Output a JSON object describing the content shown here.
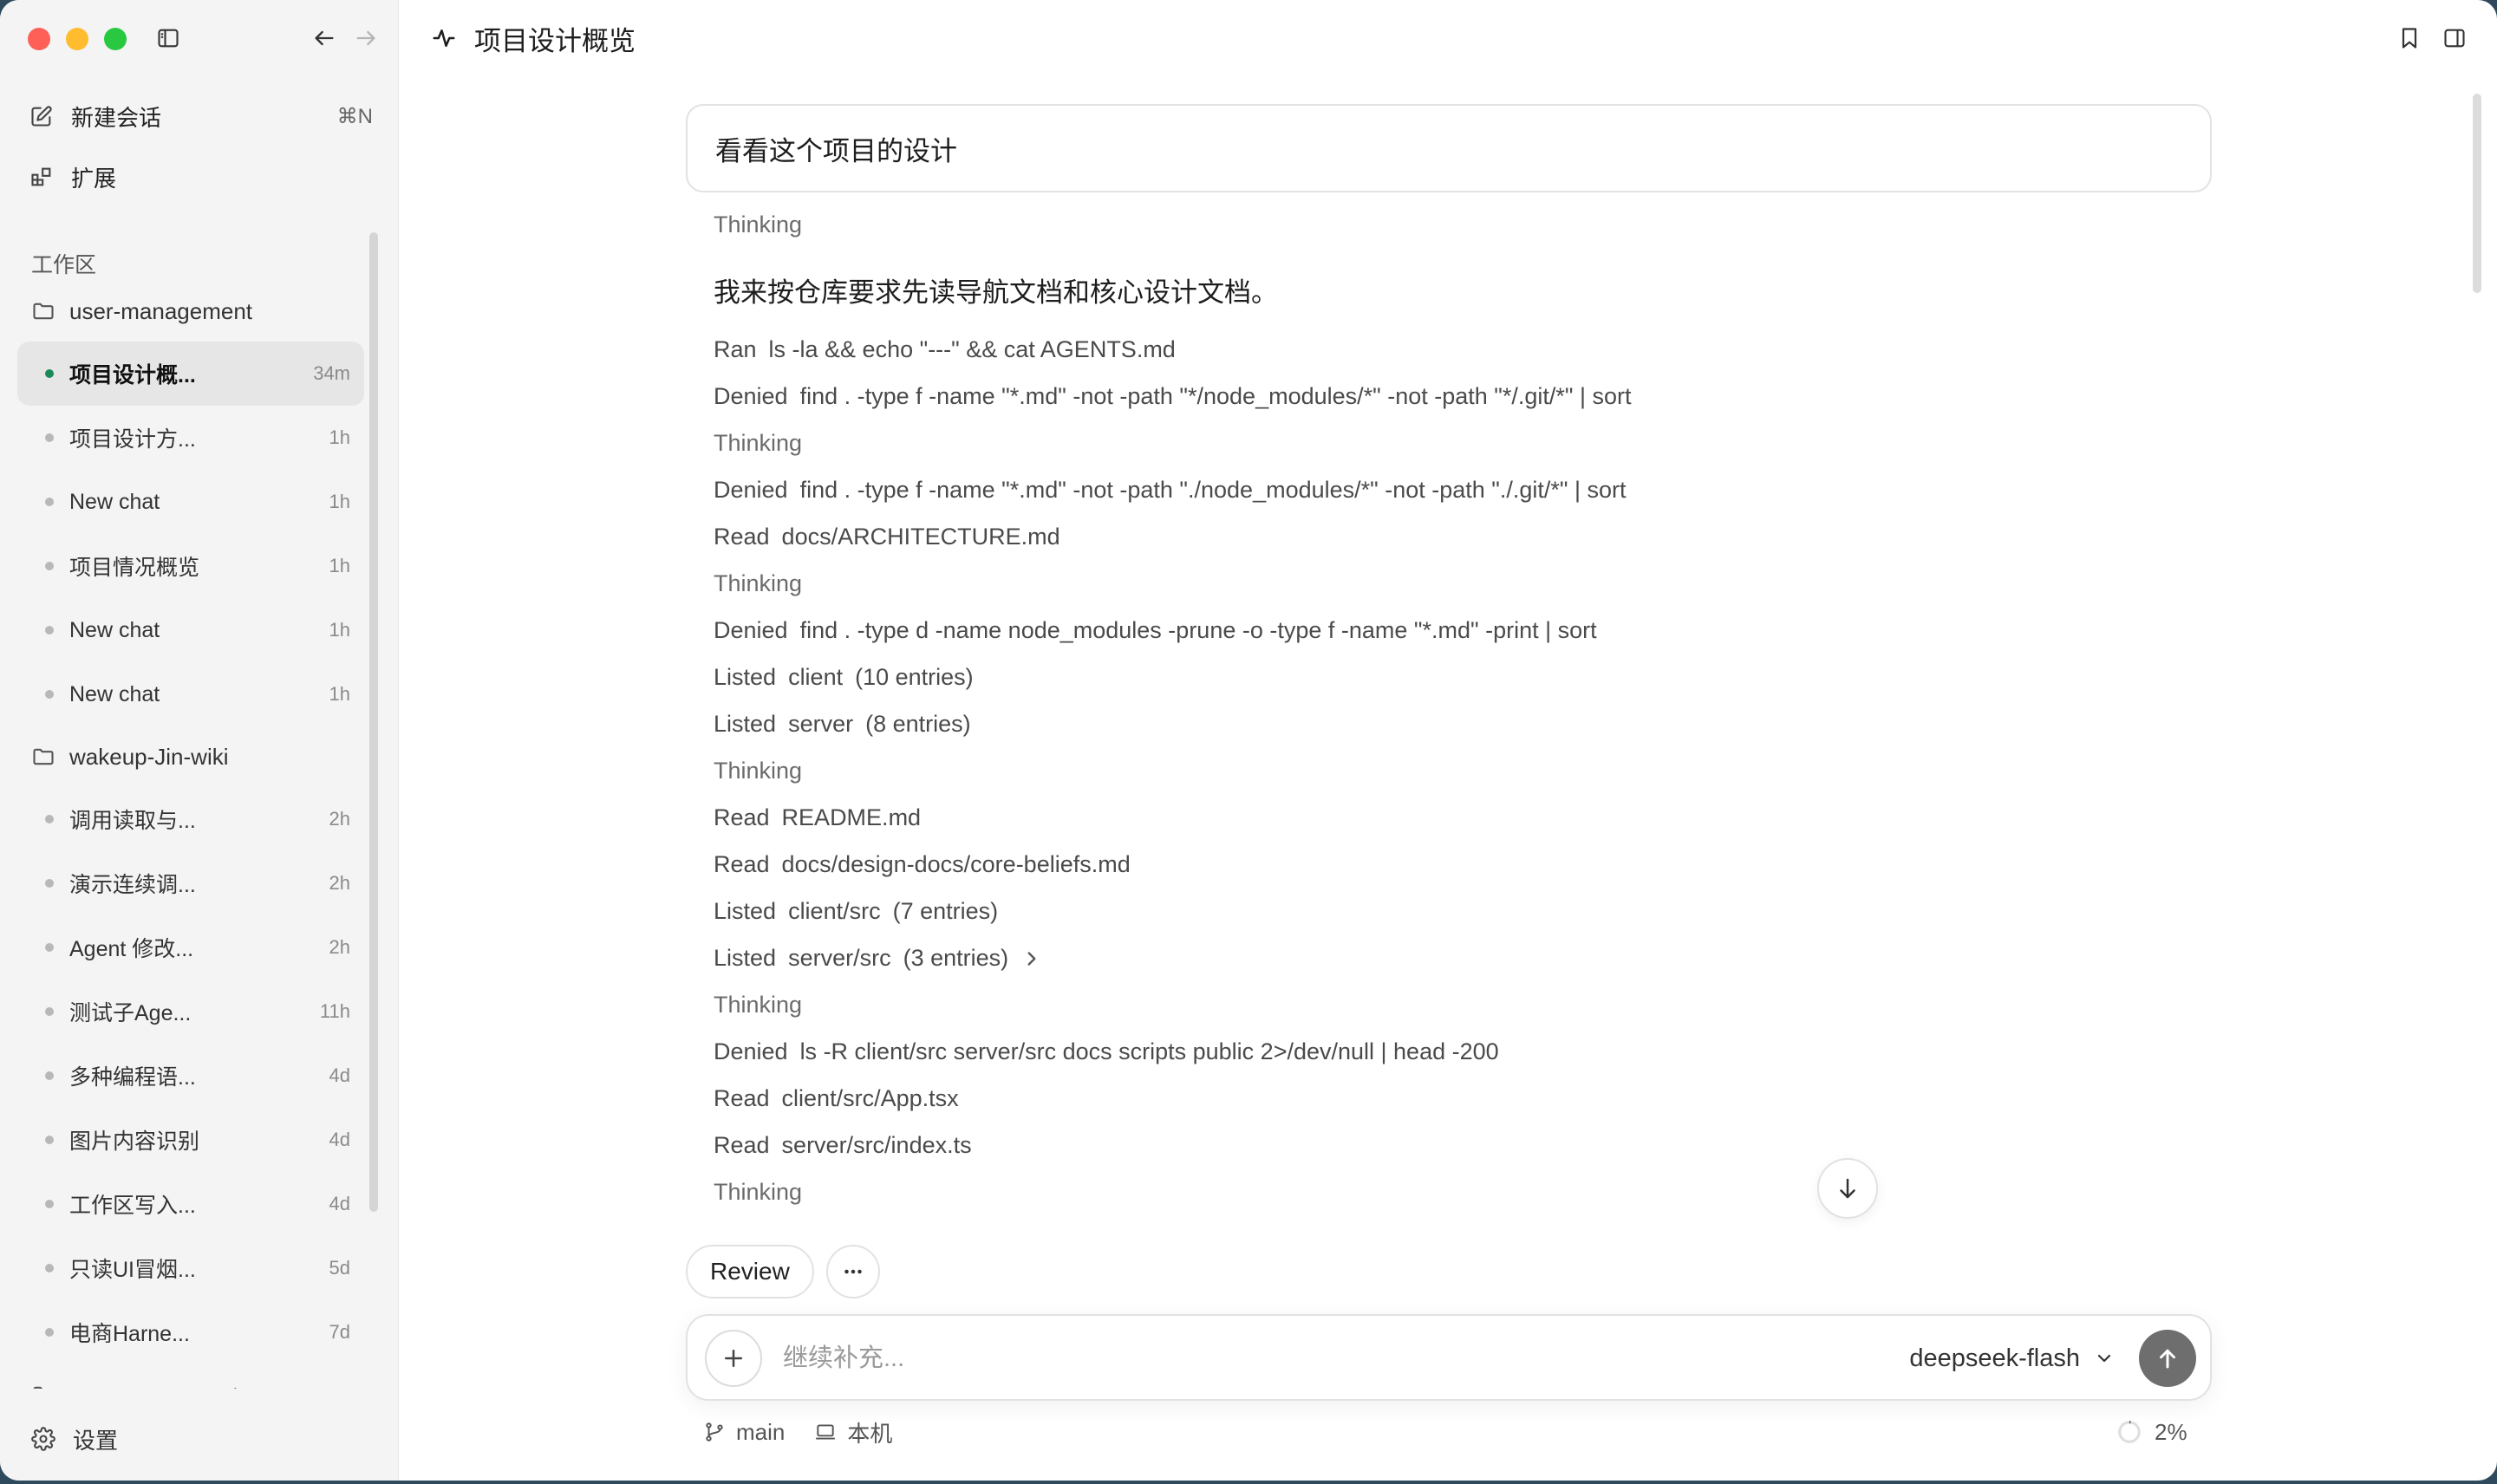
{
  "sidebar": {
    "new_chat": {
      "label": "新建会话",
      "shortcut": "⌘N"
    },
    "extensions": {
      "label": "扩展"
    },
    "section_label": "工作区",
    "workspaces": [
      {
        "name": "user-management",
        "chats": [
          {
            "title": "项目设计概...",
            "age": "34m",
            "active": true
          },
          {
            "title": "项目设计方...",
            "age": "1h"
          },
          {
            "title": "New chat",
            "age": "1h"
          },
          {
            "title": "项目情况概览",
            "age": "1h"
          },
          {
            "title": "New chat",
            "age": "1h"
          },
          {
            "title": "New chat",
            "age": "1h"
          }
        ]
      },
      {
        "name": "wakeup-Jin-wiki",
        "chats": [
          {
            "title": "调用读取与...",
            "age": "2h"
          },
          {
            "title": "演示连续调...",
            "age": "2h"
          },
          {
            "title": "Agent 修改...",
            "age": "2h"
          },
          {
            "title": "测试子Age...",
            "age": "11h"
          },
          {
            "title": "多种编程语...",
            "age": "4d"
          },
          {
            "title": "图片内容识别",
            "age": "4d"
          },
          {
            "title": "工作区写入...",
            "age": "4d"
          },
          {
            "title": "只读UI冒烟...",
            "age": "5d"
          },
          {
            "title": "电商Harne...",
            "age": "7d"
          }
        ]
      },
      {
        "name": "commerce-agent",
        "chats": []
      }
    ],
    "settings_label": "设置"
  },
  "main": {
    "title": "项目设计概览",
    "user_message": "看看这个项目的设计",
    "log": [
      {
        "kind": "thinking",
        "text": "Thinking"
      },
      {
        "kind": "assistant",
        "text": "我来按仓库要求先读导航文档和核心设计文档。"
      },
      {
        "kind": "tool",
        "verb": "Ran",
        "arg": "ls -la && echo \"---\" && cat AGENTS.md"
      },
      {
        "kind": "tool",
        "verb": "Denied",
        "arg": "find . -type f -name \"*.md\" -not -path \"*/node_modules/*\" -not -path \"*/.git/*\" | sort"
      },
      {
        "kind": "thinking",
        "text": "Thinking"
      },
      {
        "kind": "tool",
        "verb": "Denied",
        "arg": "find . -type f -name \"*.md\" -not -path \"./node_modules/*\" -not -path \"./.git/*\" | sort"
      },
      {
        "kind": "tool",
        "verb": "Read",
        "arg": "docs/ARCHITECTURE.md"
      },
      {
        "kind": "thinking",
        "text": "Thinking"
      },
      {
        "kind": "tool",
        "verb": "Denied",
        "arg": "find . -type d -name node_modules -prune -o -type f -name \"*.md\" -print | sort"
      },
      {
        "kind": "tool",
        "verb": "Listed",
        "arg": "client",
        "extra": "(10 entries)"
      },
      {
        "kind": "tool",
        "verb": "Listed",
        "arg": "server",
        "extra": "(8 entries)"
      },
      {
        "kind": "thinking",
        "text": "Thinking"
      },
      {
        "kind": "tool",
        "verb": "Read",
        "arg": "README.md"
      },
      {
        "kind": "tool",
        "verb": "Read",
        "arg": "docs/design-docs/core-beliefs.md"
      },
      {
        "kind": "tool",
        "verb": "Listed",
        "arg": "client/src",
        "extra": "(7 entries)"
      },
      {
        "kind": "tool",
        "verb": "Listed",
        "arg": "server/src",
        "extra": "(3 entries)",
        "expandable": true
      },
      {
        "kind": "thinking",
        "text": "Thinking"
      },
      {
        "kind": "tool",
        "verb": "Denied",
        "arg": "ls -R client/src server/src docs scripts public 2>/dev/null | head -200"
      },
      {
        "kind": "tool",
        "verb": "Read",
        "arg": "client/src/App.tsx"
      },
      {
        "kind": "tool",
        "verb": "Read",
        "arg": "server/src/index.ts"
      },
      {
        "kind": "thinking",
        "text": "Thinking"
      }
    ],
    "review_label": "Review",
    "composer": {
      "placeholder": "继续补充...",
      "value": "",
      "model": "deepseek-flash"
    },
    "footer": {
      "branch": "main",
      "location": "本机",
      "context_usage": "2%"
    }
  }
}
